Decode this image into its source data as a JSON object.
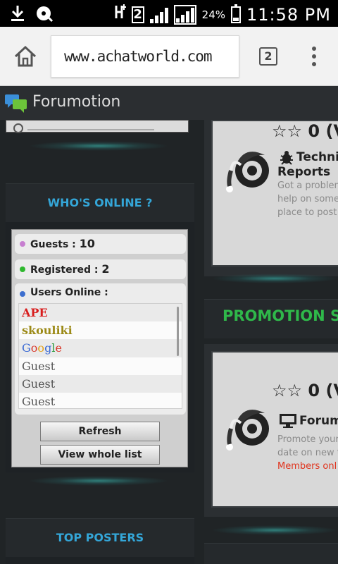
{
  "status_bar": {
    "battery_pct": "24%",
    "time": "11:58 PM",
    "sim_label": "2"
  },
  "browser": {
    "url": "www.achatworld.com",
    "tab_count": "2"
  },
  "site_bar": {
    "brand": "Forumotion"
  },
  "whos_online": {
    "title": "WHO'S ONLINE ?",
    "guests_label": "Guests : ",
    "guests_count": "10",
    "registered_label": "Registered : ",
    "registered_count": "2",
    "users_online_label": "Users Online :",
    "users": [
      "APE",
      "skouliki",
      "Google",
      "Guest",
      "Guest",
      "Guest"
    ],
    "refresh_button": "Refresh",
    "view_list_button": "View whole list"
  },
  "top_posters": {
    "title": "TOP POSTERS"
  },
  "right_column": {
    "card1": {
      "stars": "☆☆",
      "count": "0 (V",
      "title": "Techni",
      "title2": "Reports",
      "desc_lines": [
        "Got a problen",
        "help on some",
        "place to post"
      ]
    },
    "promotion_heading": "PROMOTION SE",
    "card2": {
      "stars": "☆☆",
      "count": "0 (V",
      "title": "Forum",
      "desc_lines": [
        "Promote your",
        "date on new t"
      ],
      "members_link": "Members onl"
    }
  },
  "colors": {
    "accent_blue": "#34a6d8",
    "promotion_green": "#2fb84a",
    "link_red": "#e0331c",
    "guests_dot": "#c77fd0",
    "registered_dot": "#2eb82e",
    "users_dot": "#3d6fcf"
  }
}
